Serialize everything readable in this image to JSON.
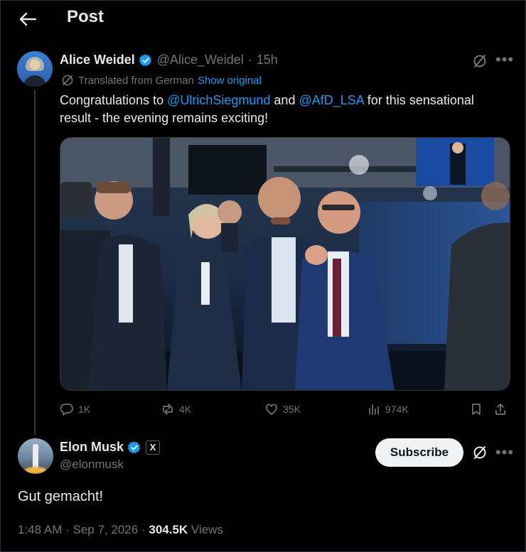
{
  "header": {
    "back_icon": "arrow-left-icon",
    "title": "Post"
  },
  "parent_post": {
    "author_name": "Alice Weidel",
    "verified_color": "#1d9bf0",
    "handle": "@Alice_Weidel",
    "separator": "·",
    "time": "15h",
    "translated_label": "Translated from German",
    "show_original": "Show original",
    "text_parts": [
      "Congratulations to ",
      "@UlrichSiegmund",
      " and ",
      "@AfD_LSA",
      " for this sensational result - the evening remains exciting!"
    ],
    "image_alt": "Photo of a group of people in suits laughing and applauding at an election evening event",
    "actions": {
      "replies": "1K",
      "reposts": "4K",
      "likes": "35K",
      "views": "974K"
    }
  },
  "reply": {
    "author_name": "Elon Musk",
    "handle": "@elonmusk",
    "affiliate_badge": "X",
    "subscribe_label": "Subscribe",
    "text": "Gut gemacht!",
    "time": "1:48 AM",
    "date": "Sep 7, 2026",
    "views_count": "304.5K",
    "views_label": "Views",
    "separator": "·"
  },
  "colors": {
    "background": "#000000",
    "text": "#e7e9ea",
    "muted": "#71767b",
    "accent": "#1d9bf0"
  }
}
